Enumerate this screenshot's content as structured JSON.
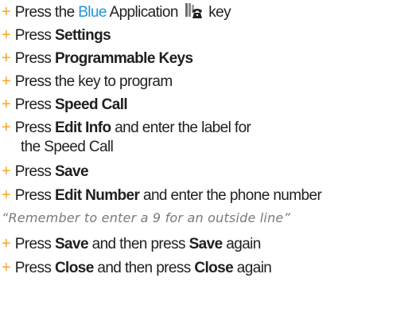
{
  "instructions": {
    "step1": {
      "pre": "Press the ",
      "highlight": "Blue",
      "mid": " Application ",
      "icon": "phone-icon",
      "post": " key"
    },
    "step2": {
      "pre": "Press ",
      "bold": "Settings"
    },
    "step3": {
      "pre": "Press ",
      "bold": "Programmable Keys"
    },
    "step4": {
      "text": "Press the key to program"
    },
    "step5": {
      "pre": "Press ",
      "bold": "Speed Call"
    },
    "step6": {
      "pre": "Press ",
      "bold": "Edit Info",
      "post": " and enter the label for",
      "line2": "the Speed Call"
    },
    "step7": {
      "pre": "Press ",
      "bold": "Save"
    },
    "step8": {
      "pre": "Press ",
      "bold": "Edit Number",
      "post": " and enter the phone number"
    },
    "note": "“Remember to enter a 9 for an outside line”",
    "step9": {
      "pre": "Press ",
      "bold1": "Save",
      "mid": " and then press ",
      "bold2": "Save",
      "post": " again"
    },
    "step10": {
      "pre": "Press ",
      "bold1": "Close",
      "mid": " and then press ",
      "bold2": "Close",
      "post": " again"
    },
    "bullet": "+"
  },
  "colors": {
    "bullet": "#f5a623",
    "highlight": "#2196d6"
  }
}
